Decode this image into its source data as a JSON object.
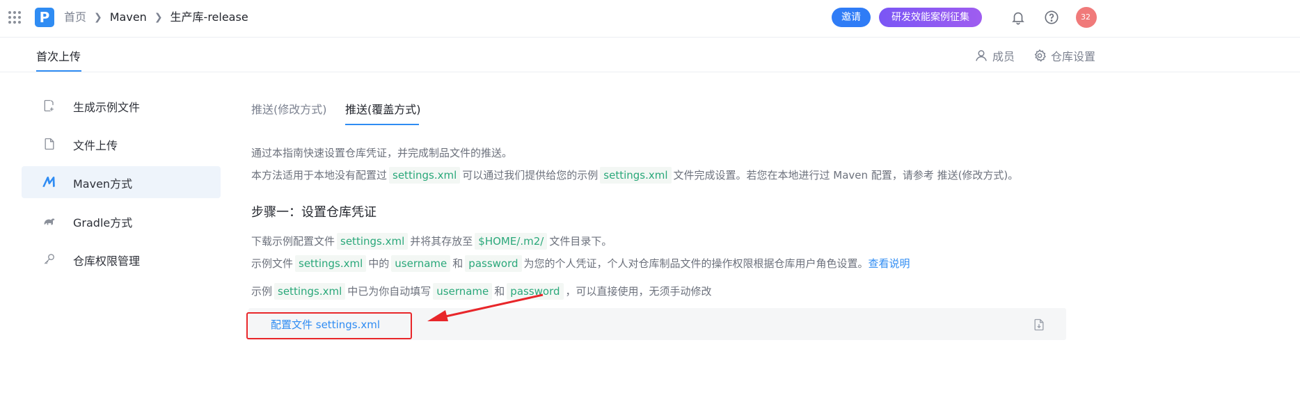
{
  "header": {
    "breadcrumb": {
      "home": "首页",
      "group": "Maven",
      "repo": "生产库-release"
    },
    "invite_label": "邀请",
    "collect_label": "研发效能案例征集",
    "avatar_text": "32",
    "accent": "#2f8cf3"
  },
  "subheader": {
    "tab_label": "首次上传",
    "members_label": "成员",
    "settings_label": "仓库设置"
  },
  "sidebar": {
    "items": [
      {
        "label": "生成示例文件",
        "icon": "file-add-icon"
      },
      {
        "label": "文件上传",
        "icon": "file-icon"
      },
      {
        "label": "Maven方式",
        "icon": "maven-icon",
        "active": true
      },
      {
        "label": "Gradle方式",
        "icon": "gradle-icon"
      },
      {
        "label": "仓库权限管理",
        "icon": "key-icon"
      }
    ]
  },
  "content": {
    "tabs": [
      {
        "label": "推送(修改方式)",
        "active": false
      },
      {
        "label": "推送(覆盖方式)",
        "active": true
      }
    ],
    "intro1": "通过本指南快速设置仓库凭证，并完成制品文件的推送。",
    "intro2": {
      "t1": "本方法适用于本地没有配置过",
      "c1": "settings.xml",
      "t2": "可以通过我们提供给您的示例",
      "c2": "settings.xml",
      "t3": "文件完成设置。若您在本地进行过 Maven 配置，请参考 推送(修改方式)。"
    },
    "step1_title": "步骤一：设置仓库凭证",
    "step1_line1": {
      "t1": "下载示例配置文件",
      "c1": "settings.xml",
      "t2": "并将其存放至",
      "c2": "$HOME/.m2/",
      "t3": "文件目录下。"
    },
    "step1_line2": {
      "t1": "示例文件",
      "c1": "settings.xml",
      "t2": "中的",
      "c2": "username",
      "t3": "和",
      "c3": "password",
      "t4": "为您的个人凭证，个人对仓库制品文件的操作权限根据仓库用户角色设置。",
      "link": "查看说明"
    },
    "step1_line3": {
      "t1": "示例",
      "c1": "settings.xml",
      "t2": "中已为你自动填写",
      "c2": "username",
      "t3": "和",
      "c3": "password",
      "t4": "，可以直接使用，无须手动修改"
    },
    "file_label": "配置文件 settings.xml",
    "highlight_color": "#e8262a"
  }
}
